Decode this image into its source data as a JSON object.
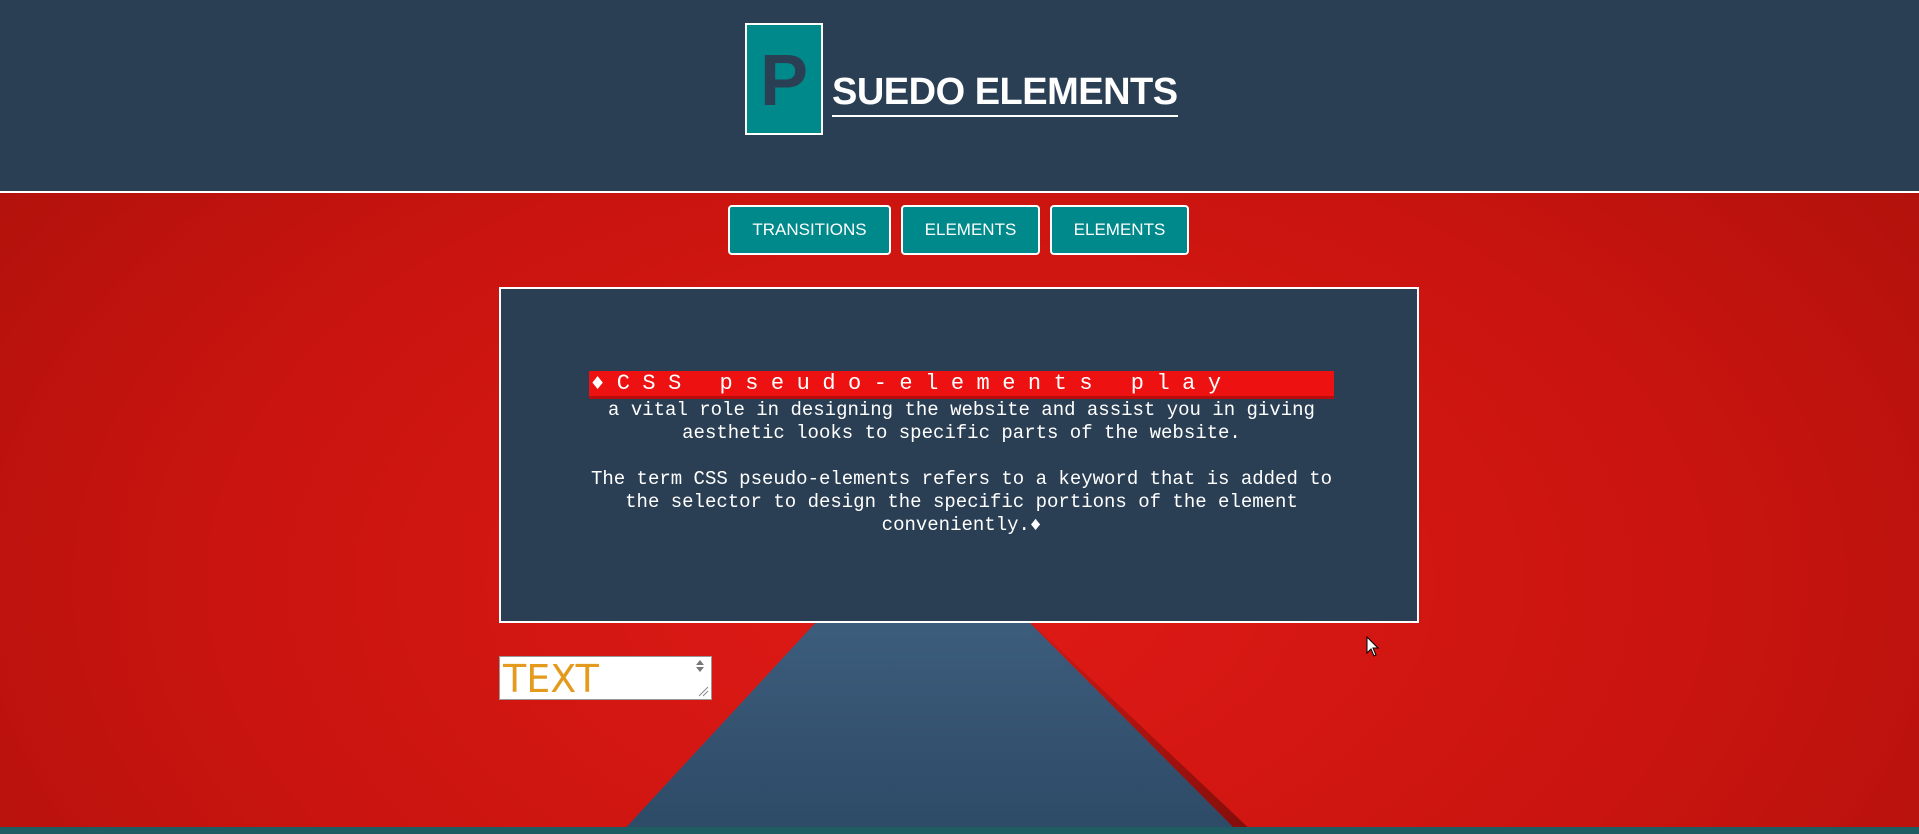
{
  "header": {
    "logo_letter": "P",
    "title": "SUEDO ELEMENTS"
  },
  "nav": {
    "buttons": [
      "TRANSITIONS",
      "ELEMENTS",
      "ELEMENTS"
    ]
  },
  "content": {
    "first_line": "♦CSS pseudo-elements play",
    "para1_rest": "a vital role in designing the website and assist you in giving aesthetic looks to specific parts of the website.",
    "para2": "The term CSS pseudo-elements refers to a keyword that is added to the selector to design the specific portions of the element conveniently.♦"
  },
  "text_input": {
    "value": "TEXT"
  },
  "colors": {
    "header_bg": "#2b3f54",
    "teal": "#00898a",
    "red_bg": "#c9150f",
    "highlight": "#ee1111",
    "input_text": "#e39a1d"
  },
  "icons": [
    "mouse-pointer-icon",
    "spinner-up-icon",
    "spinner-down-icon",
    "resize-handle-icon"
  ]
}
